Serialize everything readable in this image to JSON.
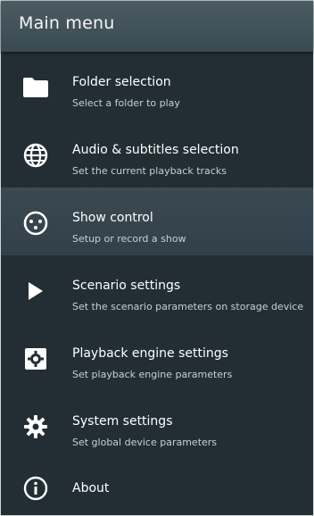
{
  "header": {
    "title": "Main menu"
  },
  "menu": {
    "items": [
      {
        "id": "folder",
        "label": "Folder selection",
        "description": "Select a folder to play",
        "icon": "folder-icon",
        "selected": false
      },
      {
        "id": "audio",
        "label": "Audio & subtitles selection",
        "description": "Set the current playback tracks",
        "icon": "globe-icon",
        "selected": false
      },
      {
        "id": "show",
        "label": "Show control",
        "description": "Setup or record a show",
        "icon": "show-control-icon",
        "selected": true
      },
      {
        "id": "scenario",
        "label": "Scenario settings",
        "description": "Set the scenario parameters on storage device",
        "icon": "play-icon",
        "selected": false
      },
      {
        "id": "engine",
        "label": "Playback engine settings",
        "description": "Set playback engine parameters",
        "icon": "engine-icon",
        "selected": false
      },
      {
        "id": "system",
        "label": "System settings",
        "description": "Set global device parameters",
        "icon": "gear-icon",
        "selected": false
      }
    ],
    "about": {
      "label": "About",
      "icon": "info-icon"
    }
  },
  "colors": {
    "background": "#222e34",
    "header": "#43535a",
    "selected": "#36454d",
    "text": "#ffffff",
    "subtext": "#c8d0d3"
  }
}
